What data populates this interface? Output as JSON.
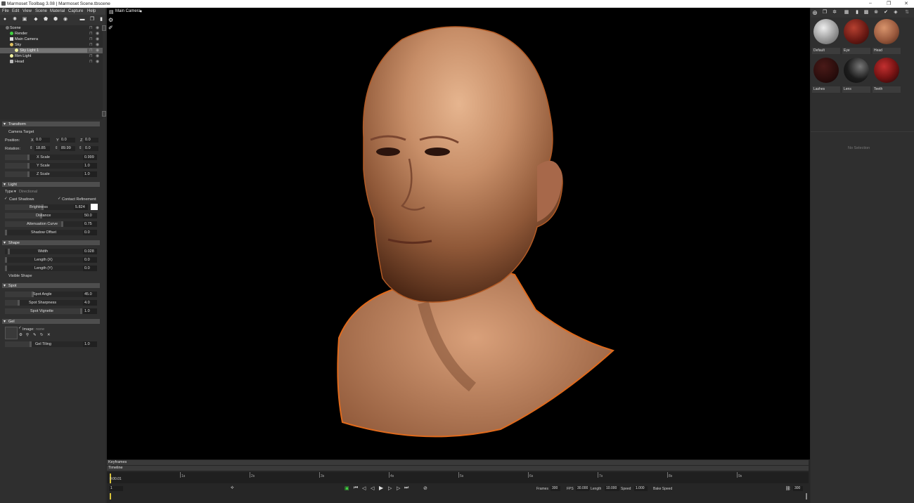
{
  "window": {
    "title": "Marmoset Toolbag 3.08  |  Marmoset Scene.tbscene",
    "minimize": "–",
    "maximize": "❐",
    "close": "✕"
  },
  "menu": [
    "File",
    "Edit",
    "View",
    "Scene",
    "Material",
    "Capture",
    "Help"
  ],
  "scene_tree": [
    {
      "label": "Scene",
      "indent": 0,
      "icon": "scene-icon"
    },
    {
      "label": "Render",
      "indent": 1,
      "icon": "render-icon"
    },
    {
      "label": "Main Camera",
      "indent": 1,
      "icon": "camera-icon"
    },
    {
      "label": "Sky",
      "indent": 1,
      "icon": "sky-icon"
    },
    {
      "label": "Sky Light 1",
      "indent": 2,
      "icon": "light-icon",
      "selected": true
    },
    {
      "label": "Rim Light",
      "indent": 1,
      "icon": "light-icon"
    },
    {
      "label": "Head",
      "indent": 1,
      "icon": "mesh-icon"
    }
  ],
  "transform": {
    "header": "Transform",
    "camera_target": "Camera Target",
    "position_label": "Position:",
    "rotation_label": "Rotation:",
    "x": "X",
    "y": "Y",
    "z": "Z",
    "pos_x": "0.0",
    "pos_y": "0.0",
    "pos_z": "0.0",
    "rot_x": "18.85",
    "rot_y": "89.99",
    "rot_z": "0.0",
    "x_scale_label": "X Scale",
    "x_scale": "0.999",
    "y_scale_label": "Y Scale",
    "y_scale": "1.0",
    "z_scale_label": "Z Scale",
    "z_scale": "1.0"
  },
  "light": {
    "header": "Light",
    "type_label": "Type",
    "type_value": "Directional",
    "cast_shadows": "Cast Shadows",
    "contact_refinement": "Contact Refinement",
    "brightness_label": "Brightness",
    "brightness": "5.824",
    "distance_label": "Distance",
    "distance": "50.0",
    "atten_label": "Attenuation Curve",
    "atten": "0.75",
    "shadow_offset_label": "Shadow Offset",
    "shadow_offset": "0.0",
    "swatch_color": "#ffffff"
  },
  "shape": {
    "header": "Shape",
    "width_label": "Width",
    "width": "0.028",
    "lx_label": "Length (X)",
    "lx": "0.0",
    "ly_label": "Length (Y)",
    "ly": "0.0",
    "visible_shape": "Visible Shape"
  },
  "spot": {
    "header": "Spot",
    "angle_label": "Spot Angle",
    "angle": "45.0",
    "sharp_label": "Spot Sharpness",
    "sharp": "4.0",
    "vignette_label": "Spot Vignette",
    "vignette": "1.0"
  },
  "gel": {
    "header": "Gel",
    "image_label": "Image:",
    "image_value": "none",
    "tiling_label": "Gel Tiling",
    "tiling": "1.0"
  },
  "viewport": {
    "camera": "Main Camera"
  },
  "materials": [
    {
      "name": "Default",
      "color": "#bdbdbd"
    },
    {
      "name": "Eye",
      "color": "#6b1a14"
    },
    {
      "name": "Head",
      "color": "#9a5a3e"
    },
    {
      "name": "Lashes",
      "color": "#2a0d0c"
    },
    {
      "name": "Lens",
      "color": "#1c1c1c"
    },
    {
      "name": "Teeth",
      "color": "#7a1414"
    }
  ],
  "no_selection": "No Selection",
  "timeline": {
    "keyframes": "Keyframes",
    "timeline": "Timeline",
    "ticks": [
      "1s",
      "2s",
      "3s",
      "4s",
      "5s",
      "6s",
      "7s",
      "8s",
      "9s"
    ],
    "current_time": "0:00.01",
    "frame": "1",
    "frames_label": "Frames",
    "frames": "300",
    "fps_label": "FPS",
    "fps": "30.000",
    "length_label": "Length",
    "length": "10.000",
    "speed_label": "Speed",
    "speed": "1.000",
    "bake_speed": "Bake Speed",
    "end_frame": "300"
  }
}
